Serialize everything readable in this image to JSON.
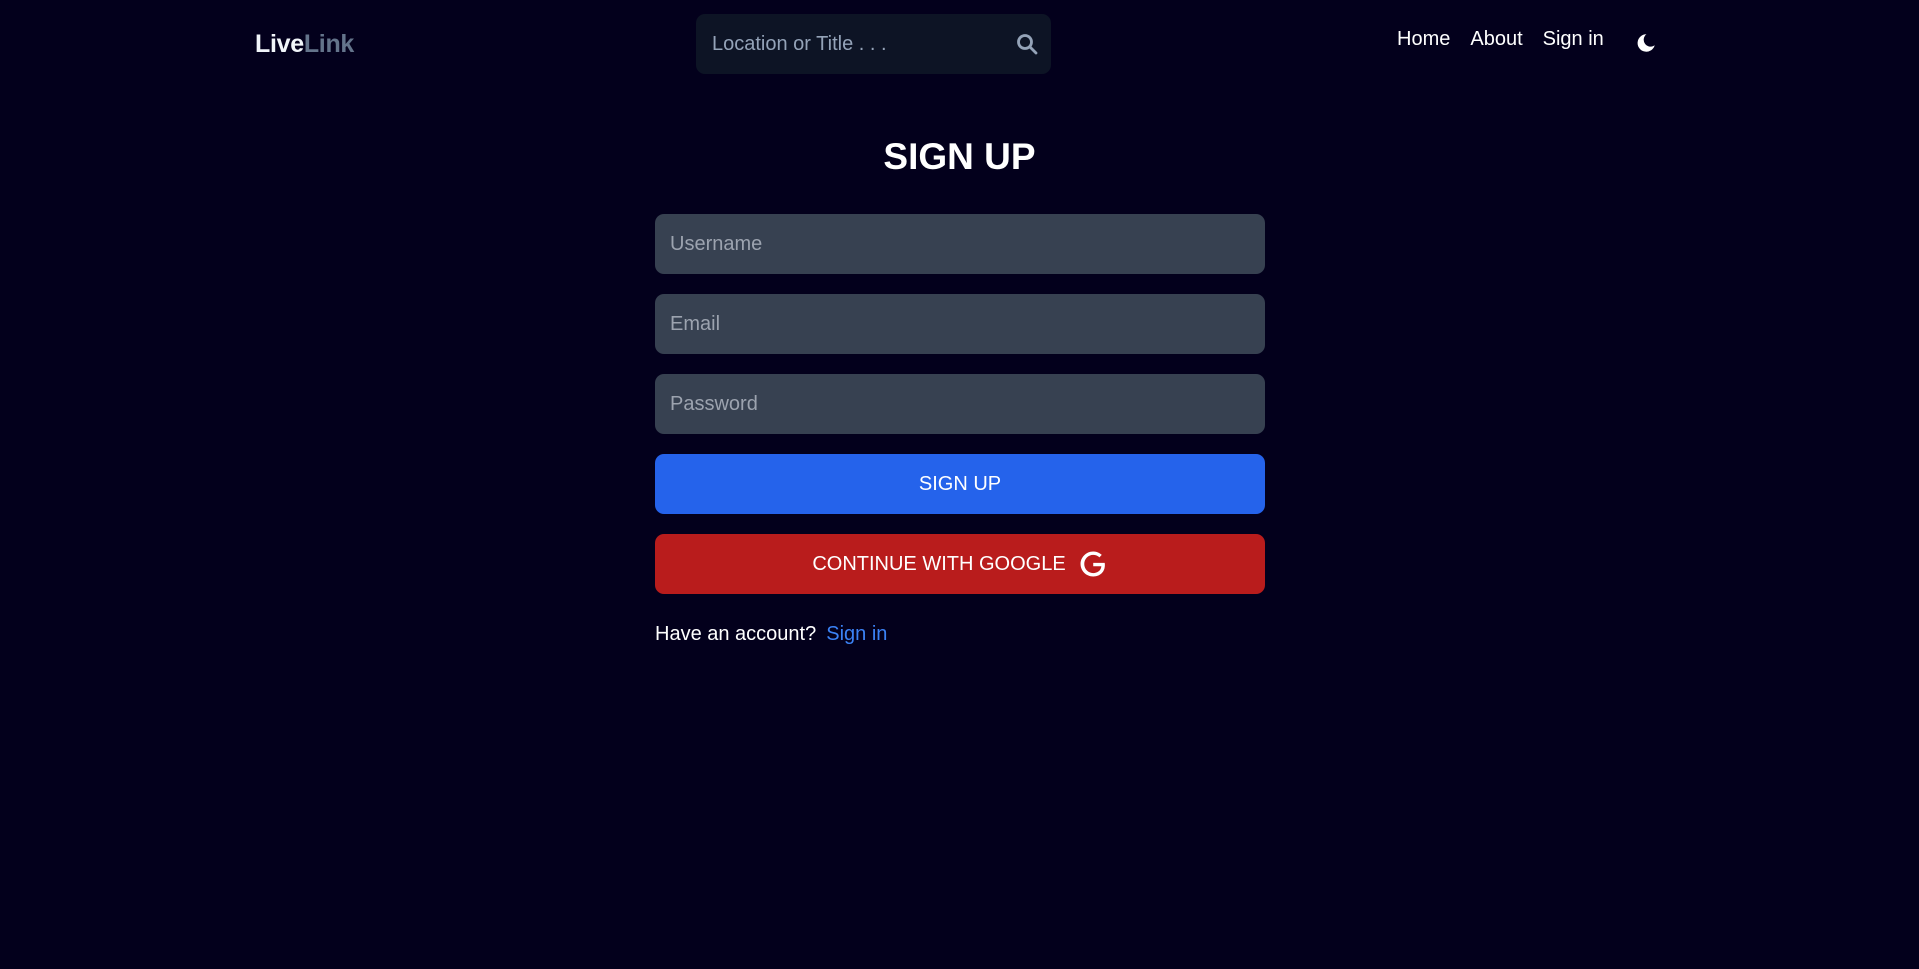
{
  "header": {
    "logo_part1": "Live",
    "logo_part2": "Link",
    "search_placeholder": "Location or Title . . .",
    "search_icon": "magnifying-glass",
    "nav": [
      "Home",
      "About",
      "Sign in"
    ],
    "theme_icon": "moon-icon"
  },
  "form": {
    "title": "SIGN UP",
    "username_placeholder": "Username",
    "email_placeholder": "Email",
    "password_placeholder": "Password",
    "signup_label": "SIGN UP",
    "google_label": "CONTINUE WITH GOOGLE",
    "google_icon": "google-g"
  },
  "footer": {
    "prompt": "Have an account?",
    "signin_link": "Sign in"
  },
  "colors": {
    "background": "#03001c",
    "input_bg": "#374151",
    "primary": "#2563eb",
    "google": "#b91c1c",
    "link": "#3b82f6"
  }
}
